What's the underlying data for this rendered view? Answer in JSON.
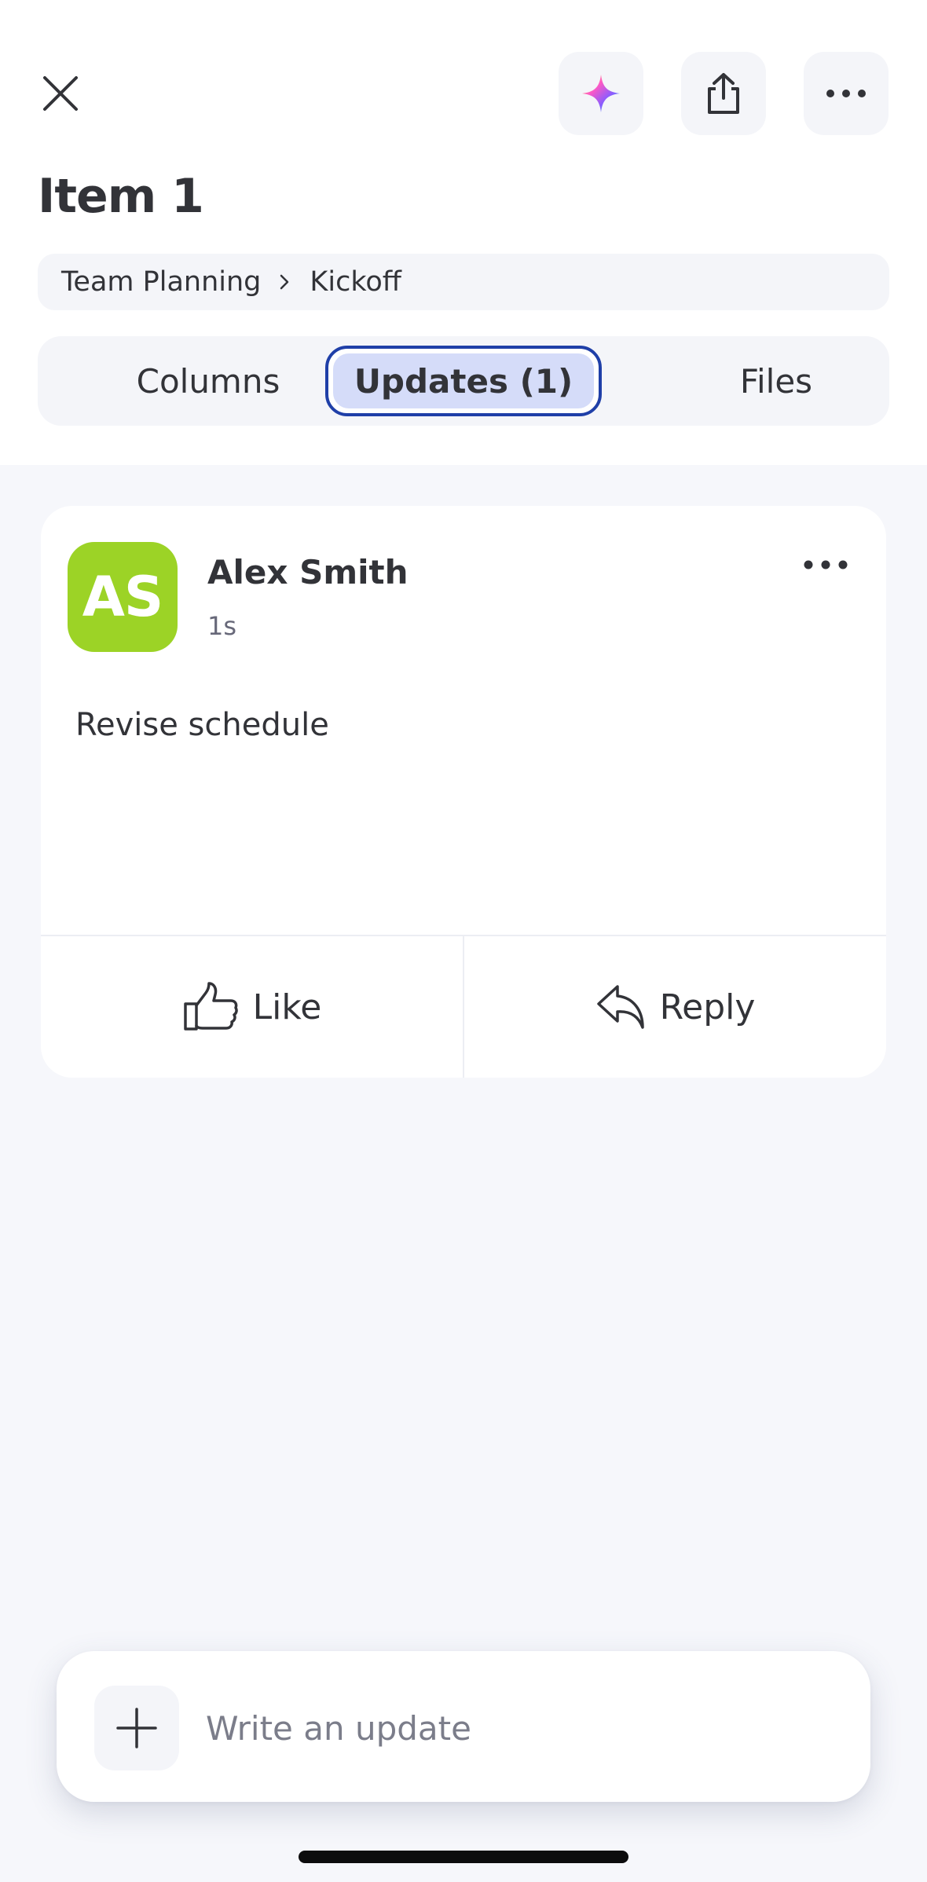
{
  "header": {
    "title": "Item 1",
    "icons": {
      "close": "close-icon",
      "ai": "sparkle-icon",
      "share": "share-icon",
      "more": "more-horizontal-icon"
    }
  },
  "breadcrumb": {
    "items": [
      "Team Planning",
      "Kickoff"
    ],
    "separator_icon": "chevron-right-icon"
  },
  "tabs": [
    {
      "label": "Columns",
      "active": false
    },
    {
      "label": "Updates (1)",
      "active": true
    },
    {
      "label": "Files",
      "active": false
    }
  ],
  "update": {
    "author": "Alex Smith",
    "initials": "AS",
    "avatar_color": "#9cd326",
    "time": "1s",
    "body": "Revise schedule",
    "actions": {
      "like_label": "Like",
      "reply_label": "Reply"
    }
  },
  "composer": {
    "placeholder": "Write an update",
    "add_icon": "plus-icon"
  },
  "colors": {
    "accent": "#1f3fa8",
    "active_tab_bg": "#d5dcf9",
    "surface": "#f6f7fb",
    "text": "#323338"
  }
}
